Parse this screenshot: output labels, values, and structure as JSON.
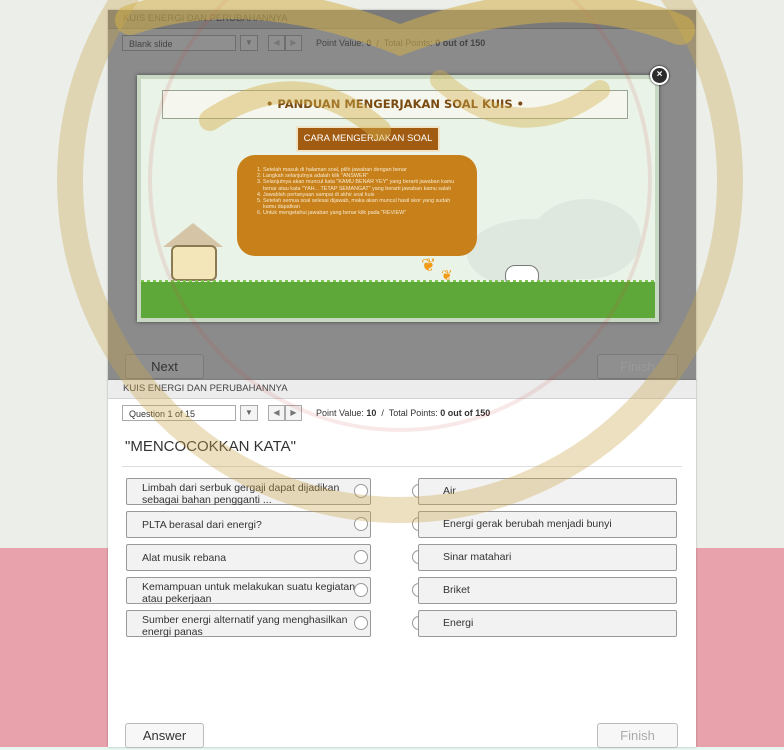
{
  "quiz_title": "KUIS ENERGI DAN PERUBAHANNYA",
  "top_panel": {
    "slide_select": "Blank slide",
    "point_value_label": "Point Value:",
    "point_value": "0",
    "total_points_label": "Total Points:",
    "total_points": "0 out of 150",
    "next_label": "Next",
    "finish_label": "Finish"
  },
  "modal": {
    "title": "• PANDUAN MENGERJAKAN SOAL KUIS •",
    "subtitle": "CARA MENGERJAKAN SOAL",
    "instructions": [
      "Setelah masuk di halaman soal, pilih jawaban dengan benar",
      "Langkah selanjutnya adalah klik \"ANSWER\"",
      "Selanjutnya akan muncul kata \"KAMU BENAR YEY\" yang berarti jawaban kamu benar atau kata \"YAH... TETAP SEMANGAT\" yang berarti jawaban kamu salah",
      "Jawablah pertanyaan sampai di akhir soal kuis",
      "Setelah semua soal selesai dijawab, maka akan muncul hasil skor yang sudah kamu dapatkan",
      "Untuk mengetahui jawaban yang benar klik pada \"REVIEW\""
    ],
    "close_label": "×"
  },
  "bottom_panel": {
    "question_select": "Question 1 of 15",
    "point_value_label": "Point Value:",
    "point_value": "10",
    "total_points_label": "Total Points:",
    "total_points": "0 out of 150",
    "question_title": "\"MENCOCOKKAN KATA\"",
    "pairs": [
      {
        "left": "Limbah dari serbuk gergaji dapat dijadikan sebagai bahan pengganti ...",
        "right": "Air"
      },
      {
        "left": "PLTA berasal dari energi?",
        "right": "Energi gerak berubah menjadi bunyi"
      },
      {
        "left": "Alat musik rebana",
        "right": "Sinar matahari"
      },
      {
        "left": "Kemampuan untuk melakukan suatu kegiatan atau pekerjaan",
        "right": "Briket"
      },
      {
        "left": "Sumber energi alternatif yang menghasilkan energi panas",
        "right": "Energi"
      }
    ],
    "answer_label": "Answer",
    "finish_label": "Finish"
  },
  "colors": {
    "pink_band": "#e8a2ac",
    "modal_accent": "#c7801a",
    "grass": "#5ea83a"
  }
}
